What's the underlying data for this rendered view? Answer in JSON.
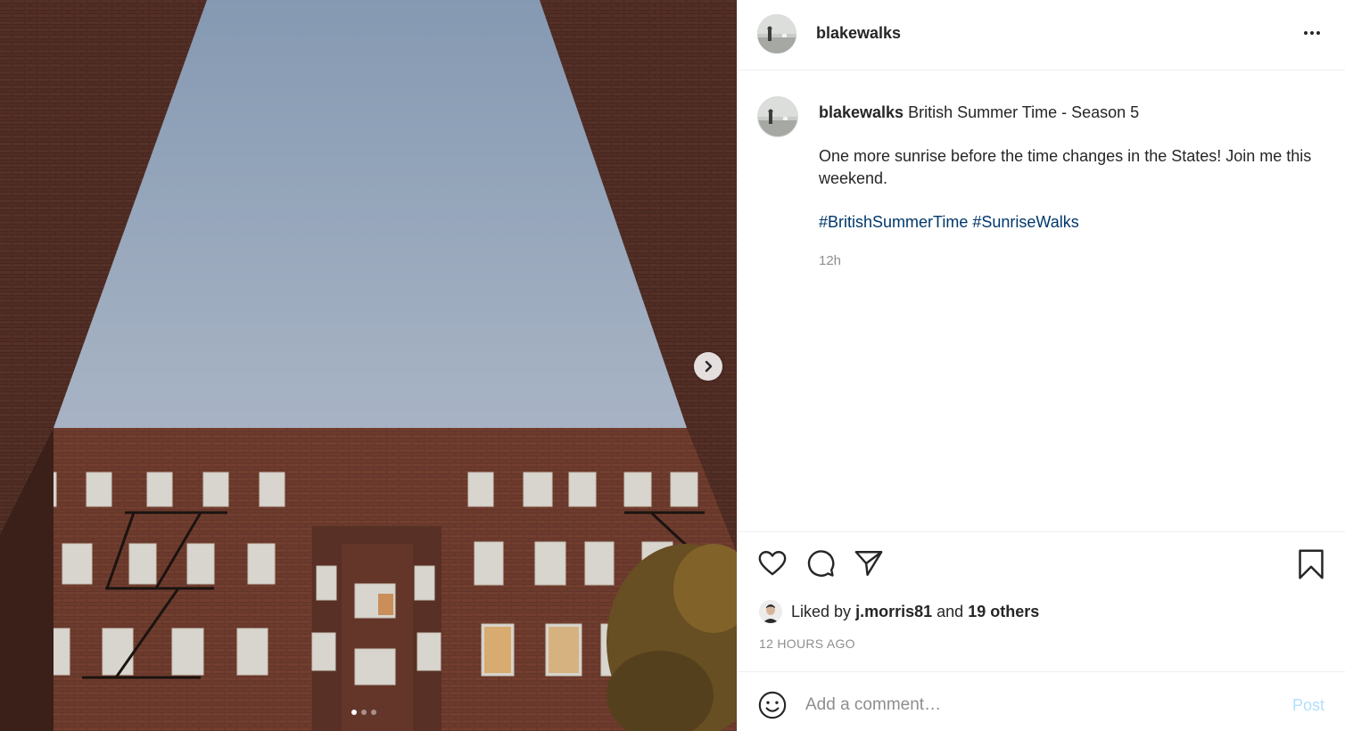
{
  "post": {
    "username": "blakewalks",
    "caption_title": "British Summer Time - Season 5",
    "caption_body": "One more sunrise before the time changes in the States! Join me this weekend.",
    "hashtags": [
      "#BritishSummerTime",
      "#SunriseWalks"
    ],
    "caption_time": "12h",
    "liked_by_prefix": "Liked by",
    "liked_by_user": "j.morris81",
    "liked_by_and": "and",
    "liked_by_others": "19 others",
    "timestamp": "12 HOURS AGO"
  },
  "comment": {
    "placeholder": "Add a comment…",
    "post_label": "Post"
  },
  "carousel": {
    "current": 1,
    "total": 3
  },
  "icons": {
    "like": "heart-icon",
    "comment": "comment-icon",
    "share": "paper-plane-icon",
    "save": "bookmark-icon",
    "emoji": "smiley-icon",
    "more": "ellipsis-icon",
    "next": "chevron-right-icon"
  },
  "colors": {
    "hashtag": "#00376b",
    "muted": "#8e8e8e",
    "post_button_disabled": "#b2dffc"
  }
}
